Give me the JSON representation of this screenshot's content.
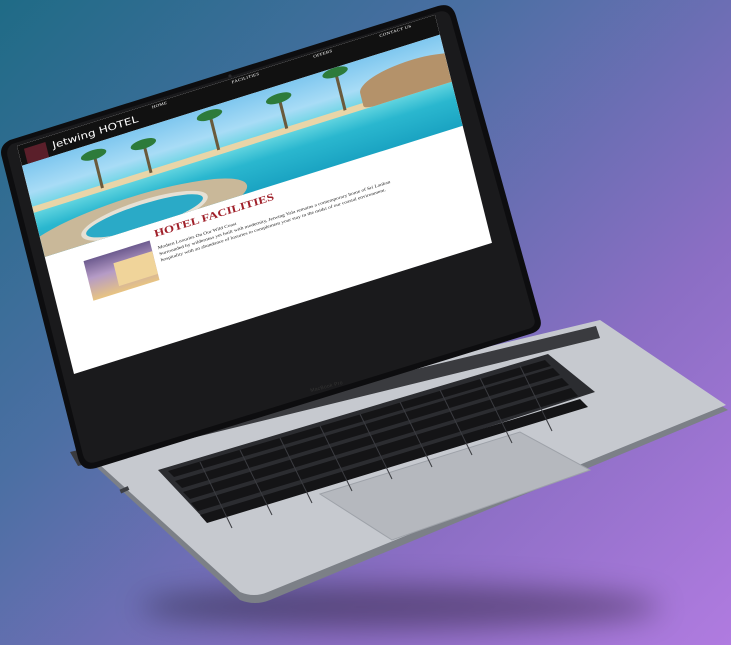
{
  "site": {
    "brand": "Jetwing HOTEL",
    "nav": [
      "HOME",
      "FACILITIES",
      "OFFERS",
      "CONTACT US"
    ],
    "section_title": "HOTEL FACILITIES",
    "paragraph_lines": [
      "Modern Luxuries On Our Wild Coast",
      "Surrounded by wilderness yet built with modernity, Jetwing Yala remains a contemporary home of Sri Lankan",
      "hospitality with an abundance of luxuries to complement your stay in the midst of our coastal environment."
    ]
  },
  "device": {
    "label": "MacBook Pro"
  }
}
